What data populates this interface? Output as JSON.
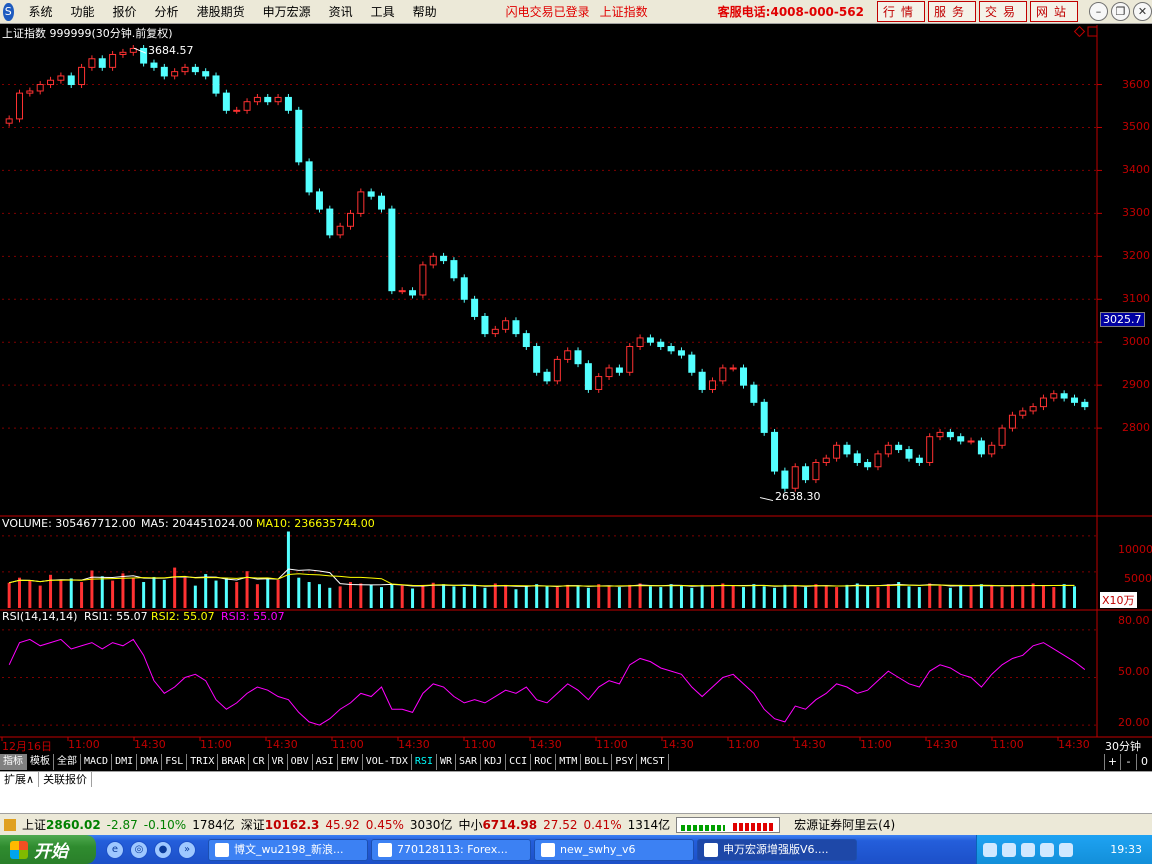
{
  "menu": {
    "logo_text": "S",
    "items": [
      "系统",
      "功能",
      "报价",
      "分析",
      "港股期货",
      "申万宏源",
      "资讯",
      "工具",
      "帮助"
    ],
    "flash_status": "闪电交易已登录",
    "flash_index": "上证指数",
    "hotline": "客服电话:4008-000-562",
    "buttons": [
      "行情",
      "服务",
      "交易",
      "网站"
    ]
  },
  "chart": {
    "title": "上证指数 999999(30分钟.前复权)",
    "high_label": "3684.57",
    "low_label": "2638.30",
    "current_price": "3025.7",
    "y_ticks": [
      "3600",
      "3500",
      "3400",
      "3300",
      "3200",
      "3100",
      "3000",
      "2900",
      "2800"
    ],
    "volume_label": "VOLUME: 305467712.00",
    "ma5_label": "MA5: 204451024.00",
    "ma10_label": "MA10: 236635744.00",
    "volume_ticks": [
      "10000",
      "5000"
    ],
    "volume_unit": "X10万",
    "rsi_label": "RSI(14,14,14)",
    "rsi1_label": "RSI1: 55.07",
    "rsi2_label": "RSI2: 55.07",
    "rsi3_label": "RSI3: 55.07",
    "rsi_ticks": [
      "80.00",
      "50.00",
      "20.00"
    ],
    "x_labels": [
      "12月16日",
      "11:00",
      "14:30",
      "11:00",
      "14:30",
      "11:00",
      "14:30",
      "11:00",
      "14:30",
      "11:00",
      "14:30",
      "11:00",
      "14:30",
      "11:00",
      "14:30",
      "11:00",
      "14:30"
    ],
    "period_label": "30分钟"
  },
  "chart_data": {
    "type": "candlestick",
    "title": "上证指数 999999(30分钟.前复权)",
    "y_range": [
      2600,
      3720
    ],
    "high": 3684.57,
    "low": 2638.3,
    "current": 3025.7,
    "close_path": [
      3520,
      3580,
      3585,
      3600,
      3610,
      3620,
      3600,
      3640,
      3660,
      3640,
      3670,
      3675,
      3684,
      3650,
      3640,
      3620,
      3630,
      3640,
      3630,
      3620,
      3580,
      3540,
      3540,
      3560,
      3570,
      3560,
      3570,
      3540,
      3420,
      3350,
      3310,
      3250,
      3270,
      3300,
      3350,
      3340,
      3310,
      3120,
      3120,
      3110,
      3180,
      3200,
      3190,
      3150,
      3100,
      3060,
      3020,
      3030,
      3050,
      3020,
      2990,
      2930,
      2910,
      2960,
      2980,
      2950,
      2890,
      2920,
      2940,
      2930,
      2990,
      3010,
      3000,
      2990,
      2980,
      2970,
      2930,
      2890,
      2910,
      2940,
      2940,
      2900,
      2860,
      2790,
      2700,
      2660,
      2710,
      2680,
      2720,
      2730,
      2760,
      2740,
      2720,
      2710,
      2740,
      2760,
      2750,
      2730,
      2720,
      2780,
      2790,
      2780,
      2770,
      2770,
      2740,
      2760,
      2800,
      2830,
      2840,
      2850,
      2870,
      2880,
      2870,
      2860,
      2850
    ],
    "volume": [
      3500,
      4200,
      3800,
      3100,
      4600,
      3900,
      4100,
      3600,
      5200,
      4400,
      3800,
      4800,
      4100,
      3600,
      4300,
      3900,
      5600,
      4200,
      3100,
      4700,
      3800,
      4200,
      3600,
      5100,
      3300,
      4100,
      3900,
      10600,
      4200,
      3600,
      3300,
      2800,
      3000,
      3600,
      3400,
      3200,
      2900,
      3300,
      3100,
      2700,
      3200,
      3500,
      3300,
      3000,
      2900,
      3100,
      2800,
      3400,
      3200,
      2600,
      3000,
      3300,
      3100,
      2900,
      3200,
      3000,
      2800,
      3300,
      3100,
      2900,
      3200,
      3400,
      3000,
      2900,
      3300,
      3100,
      2800,
      3200,
      3000,
      3400,
      3100,
      2900,
      3300,
      3000,
      2800,
      3200,
      3100,
      2900,
      3300,
      3000,
      2900,
      3200,
      3400,
      3100,
      2900,
      3300,
      3600,
      3000,
      2900,
      3400,
      3100,
      2800,
      3200,
      3000,
      3300,
      3100,
      2900,
      3200,
      3000,
      3400,
      3100,
      2900,
      3300,
      3000
    ],
    "rsi": [
      58,
      72,
      74,
      70,
      72,
      74,
      68,
      70,
      72,
      68,
      72,
      70,
      74,
      64,
      48,
      40,
      44,
      50,
      52,
      48,
      36,
      30,
      34,
      40,
      44,
      42,
      38,
      36,
      28,
      22,
      20,
      24,
      30,
      34,
      40,
      38,
      44,
      30,
      30,
      28,
      40,
      46,
      44,
      38,
      34,
      36,
      34,
      38,
      42,
      40,
      44,
      36,
      34,
      40,
      46,
      42,
      36,
      44,
      48,
      46,
      58,
      62,
      60,
      56,
      54,
      52,
      44,
      38,
      44,
      50,
      52,
      46,
      40,
      30,
      24,
      22,
      32,
      30,
      36,
      40,
      46,
      44,
      40,
      42,
      48,
      54,
      50,
      46,
      44,
      54,
      58,
      56,
      52,
      50,
      44,
      52,
      58,
      62,
      64,
      70,
      72,
      68,
      64,
      60,
      55
    ]
  },
  "tabs": [
    "指标",
    "模板",
    "全部",
    "MACD",
    "DMI",
    "DMA",
    "FSL",
    "TRIX",
    "BRAR",
    "CR",
    "VR",
    "OBV",
    "ASI",
    "EMV",
    "VOL-TDX",
    "RSI",
    "WR",
    "SAR",
    "KDJ",
    "CCI",
    "ROC",
    "MTM",
    "BOLL",
    "PSY",
    "MCST"
  ],
  "tab_controls": [
    "+",
    "-",
    "0"
  ],
  "subtabs": [
    "扩展∧",
    "关联报价"
  ],
  "status": {
    "sh_label": "上证",
    "sh_value": "2860.02",
    "sh_change": "-2.87",
    "sh_pct": "-0.10%",
    "sh_amount": "1784亿",
    "sz_label": "深证",
    "sz_value": "10162.3",
    "sz_change": "45.92",
    "sz_pct": "0.45%",
    "sz_amount": "3030亿",
    "zx_label": "中小",
    "zx_value": "6714.98",
    "zx_change": "27.52",
    "zx_pct": "0.41%",
    "zx_amount": "1314亿",
    "broker": "宏源证券阿里云(4)"
  },
  "taskbar": {
    "start": "开始",
    "tasks": [
      "博文_wu2198_新浪...",
      "770128113: Forex...",
      "new_swhy_v6",
      "申万宏源增强版V6...."
    ],
    "clock": "19:33"
  }
}
